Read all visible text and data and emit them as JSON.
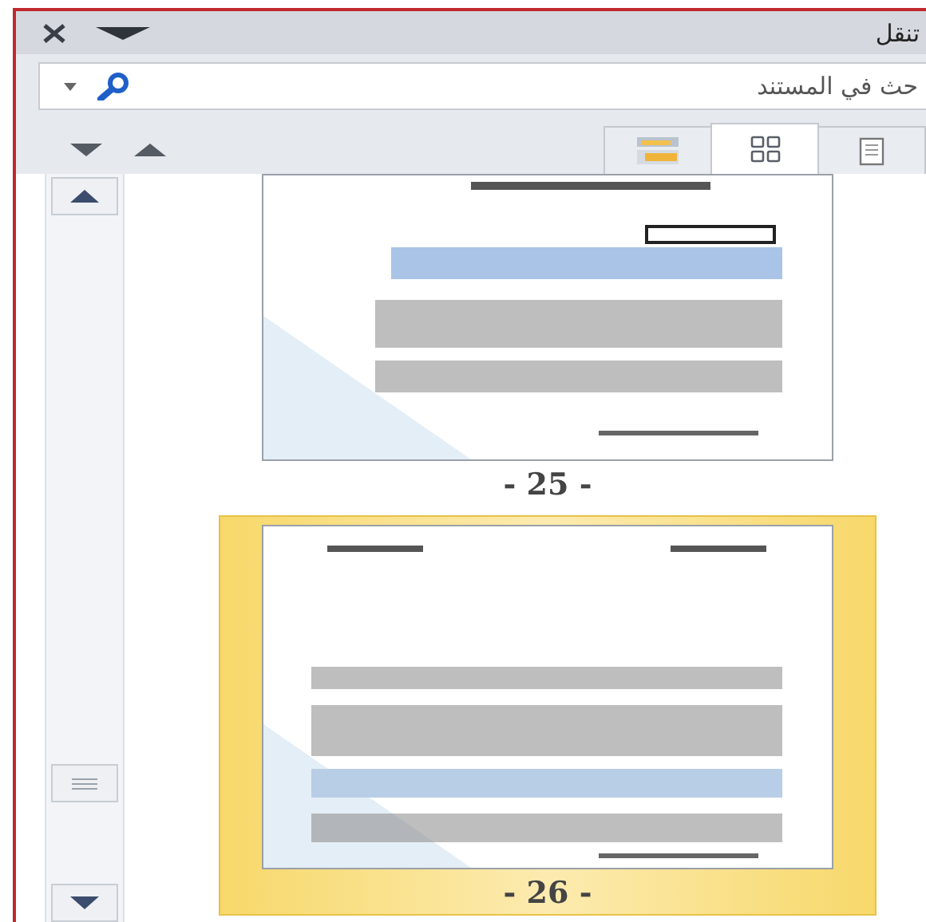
{
  "pane": {
    "title": "تنقل",
    "search": {
      "placeholder": "حث في المستند"
    },
    "tabs": [
      {
        "kind": "pages",
        "selected": false
      },
      {
        "kind": "thumbnails",
        "selected": true
      },
      {
        "kind": "headings",
        "selected": false
      }
    ],
    "pages": [
      {
        "number": "- 25 -",
        "selected": false
      },
      {
        "number": "- 26 -",
        "selected": true
      }
    ]
  }
}
